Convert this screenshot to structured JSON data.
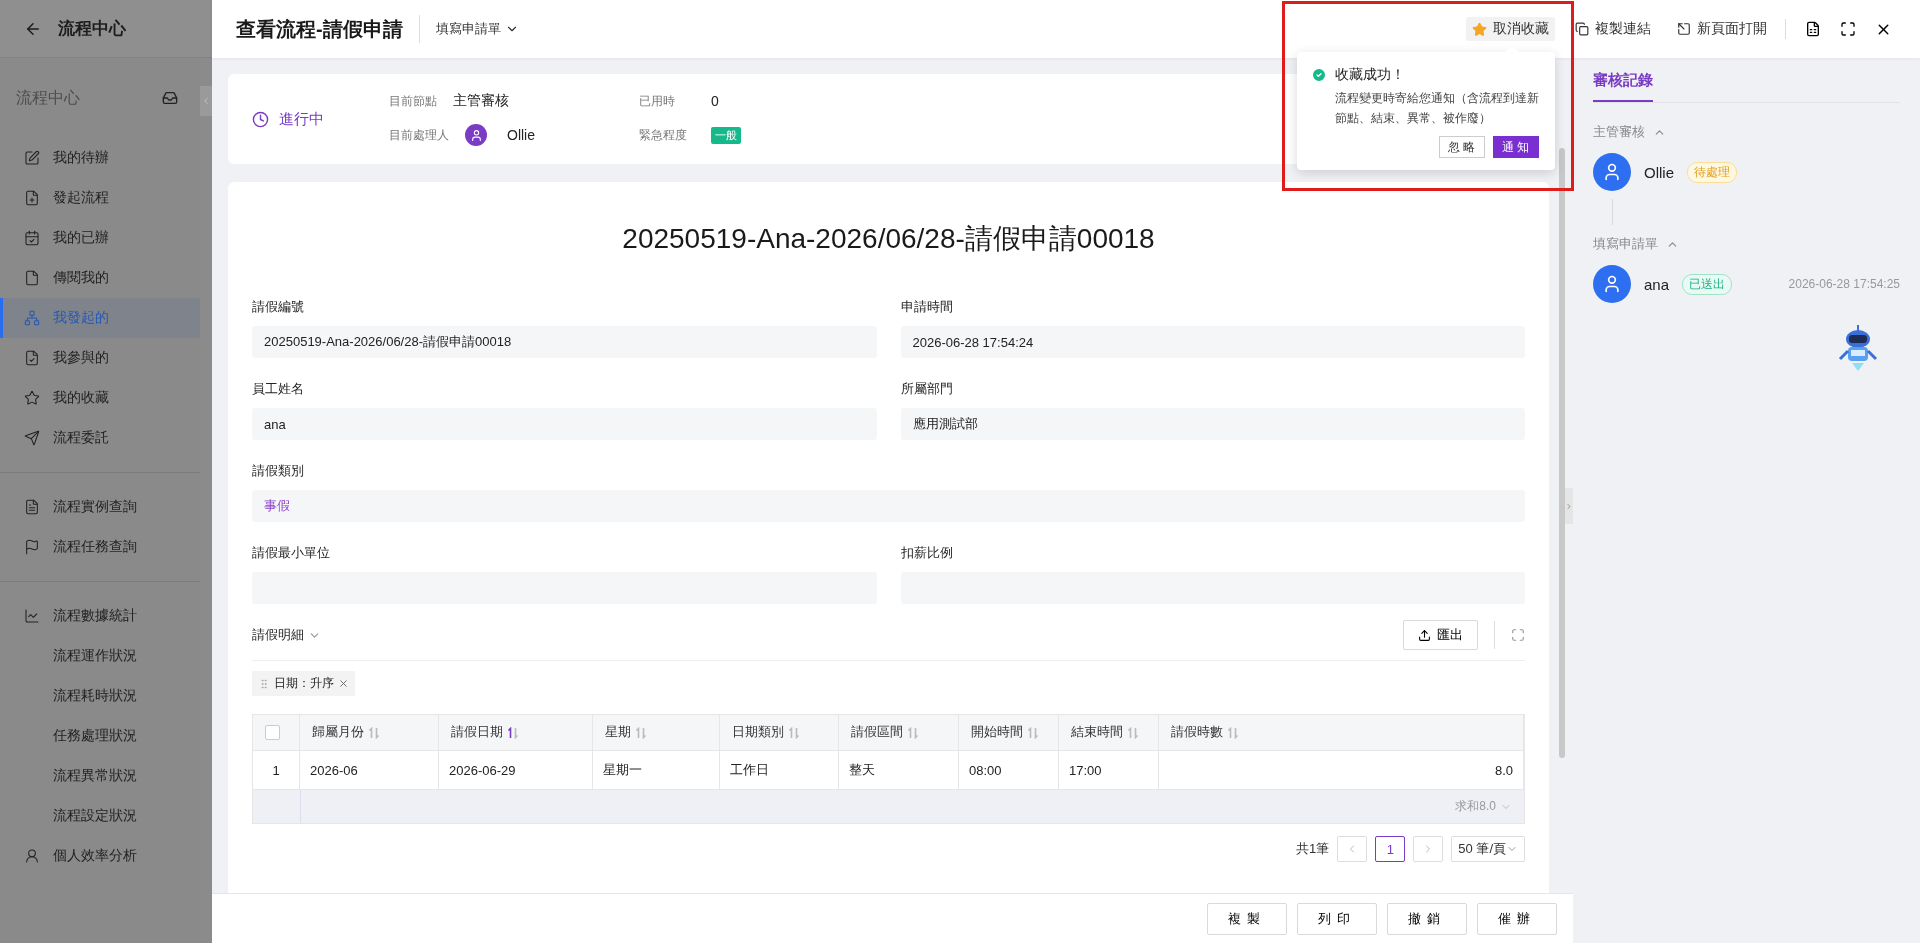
{
  "sidebar": {
    "back_title": "流程中心",
    "section_title": "流程中心",
    "groups": [
      [
        {
          "label": "我的待辦",
          "selected": false
        },
        {
          "label": "發起流程",
          "selected": false
        },
        {
          "label": "我的已辦",
          "selected": false
        },
        {
          "label": "傳閱我的",
          "selected": false
        },
        {
          "label": "我發起的",
          "selected": true
        },
        {
          "label": "我參與的",
          "selected": false
        },
        {
          "label": "我的收藏",
          "selected": false
        },
        {
          "label": "流程委託",
          "selected": false
        }
      ],
      [
        {
          "label": "流程實例查詢",
          "selected": false
        },
        {
          "label": "流程任務查詢",
          "selected": false
        }
      ],
      [
        {
          "label": "流程數據統計",
          "selected": false
        },
        {
          "label": "流程運作狀況",
          "selected": false
        },
        {
          "label": "流程耗時狀況",
          "selected": false
        },
        {
          "label": "任務處理狀況",
          "selected": false
        },
        {
          "label": "流程異常狀況",
          "selected": false
        },
        {
          "label": "流程設定狀況",
          "selected": false
        },
        {
          "label": "個人效率分析",
          "selected": false
        }
      ]
    ]
  },
  "header": {
    "title": "查看流程-請假申請",
    "step": "填寫申請單",
    "actions": [
      {
        "label": "取消收藏",
        "kind": "star",
        "highlighted": true
      },
      {
        "label": "複製連結",
        "kind": "copy",
        "highlighted": false
      },
      {
        "label": "新頁面打開",
        "kind": "open",
        "highlighted": false
      }
    ]
  },
  "popover": {
    "title": "收藏成功！",
    "message": "流程變更時寄給您通知（含流程到達新節點、結束、異常、被作廢）",
    "buttons": [
      {
        "label": "忽略",
        "primary": false
      },
      {
        "label": "通知",
        "primary": true
      }
    ]
  },
  "status": {
    "state": "進行中",
    "node_label": "目前節點",
    "node": "主管審核",
    "elapsed_label": "已用時",
    "elapsed": "0",
    "handler_label": "目前處理人",
    "handler": "Ollie",
    "urgency_label": "緊急程度",
    "urgency": "一般"
  },
  "form": {
    "title": "20250519-Ana-2026/06/28-請假申請00018",
    "fields": [
      {
        "label": "請假編號",
        "value": "20250519-Ana-2026/06/28-請假申請00018",
        "full": false,
        "kind": "text"
      },
      {
        "label": "申請時間",
        "value": "2026-06-28 17:54:24",
        "full": false,
        "kind": "text"
      },
      {
        "label": "員工姓名",
        "value": "ana",
        "full": false,
        "kind": "text"
      },
      {
        "label": "所屬部門",
        "value": "應用測試部",
        "full": false,
        "kind": "text"
      },
      {
        "label": "請假類別",
        "value": "事假",
        "full": true,
        "kind": "option"
      },
      {
        "label": "請假最小單位",
        "full": false,
        "kind": "text"
      },
      {
        "label": "扣薪比例",
        "full": false,
        "kind": "text"
      }
    ]
  },
  "detail": {
    "title": "請假明細",
    "export": "匯出",
    "sort_chip": "日期：升序",
    "all_checked": false,
    "columns": [
      {
        "label": "歸屬月份",
        "sorted": false
      },
      {
        "label": "請假日期",
        "sorted": true
      },
      {
        "label": "星期",
        "sorted": false
      },
      {
        "label": "日期類別",
        "sorted": false
      },
      {
        "label": "請假區間",
        "sorted": false
      },
      {
        "label": "開始時間",
        "sorted": false
      },
      {
        "label": "結束時間",
        "sorted": false
      },
      {
        "label": "請假時數",
        "sorted": false
      }
    ],
    "rows": [
      {
        "index": "1",
        "cells": [
          "2026-06",
          "2026-06-29",
          "星期一",
          "工作日",
          "整天",
          "08:00",
          "17:00",
          "8.0"
        ]
      }
    ],
    "summary": "求和8.0",
    "pagination": {
      "total": "共1筆",
      "page": "1",
      "page_size": "50 筆/頁"
    }
  },
  "bottom_buttons": [
    "複製",
    "列印",
    "撤銷",
    "催辦"
  ],
  "review": {
    "tab": "審核記錄",
    "tab_selected": true,
    "groups": [
      {
        "title": "主管審核",
        "expanded": true,
        "entries": [
          {
            "name": "Ollie",
            "status": "待處理",
            "kind": "pending"
          }
        ]
      },
      {
        "title": "填寫申請單",
        "expanded": true,
        "entries": [
          {
            "name": "ana",
            "status": "已送出",
            "kind": "sent",
            "time": "2026-06-28 17:54:25"
          }
        ]
      }
    ]
  }
}
